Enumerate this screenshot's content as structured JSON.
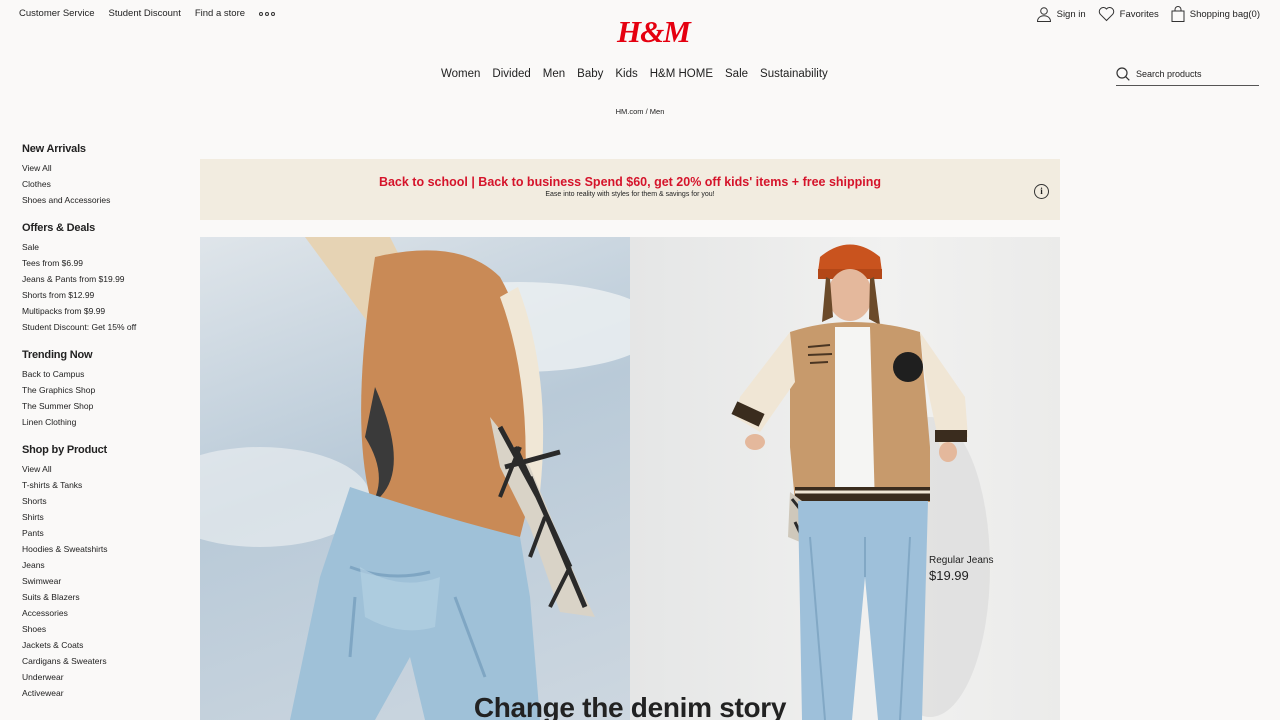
{
  "utility": {
    "customer_service": "Customer Service",
    "student_discount": "Student Discount",
    "find_store": "Find a store",
    "sign_in": "Sign in",
    "favorites": "Favorites",
    "shopping_bag": "Shopping bag(0)"
  },
  "logo": "H&M",
  "nav": [
    "Women",
    "Divided",
    "Men",
    "Baby",
    "Kids",
    "H&M HOME",
    "Sale",
    "Sustainability"
  ],
  "search": {
    "placeholder": "Search products"
  },
  "breadcrumb": "HM.com / Men",
  "sidebar": [
    {
      "title": "New Arrivals",
      "items": [
        "View All",
        "Clothes",
        "Shoes and Accessories"
      ]
    },
    {
      "title": "Offers & Deals",
      "items": [
        "Sale",
        "Tees from $6.99",
        "Jeans & Pants from $19.99",
        "Shorts from $12.99",
        "Multipacks from $9.99",
        "Student Discount: Get 15% off"
      ]
    },
    {
      "title": "Trending Now",
      "items": [
        "Back to Campus",
        "The Graphics Shop",
        "The Summer Shop",
        "Linen Clothing"
      ]
    },
    {
      "title": "Shop by Product",
      "items": [
        "View All",
        "T-shirts & Tanks",
        "Shorts",
        "Shirts",
        "Pants",
        "Hoodies & Sweatshirts",
        "Jeans",
        "Swimwear",
        "Suits & Blazers",
        "Accessories",
        "Shoes",
        "Jackets & Coats",
        "Cardigans & Sweaters",
        "Underwear",
        "Activewear"
      ]
    }
  ],
  "banner": {
    "headline": "Back to school | Back to business Spend $60, get 20% off kids' items + free shipping",
    "sub": "Ease into reality with styles for them & savings for you!",
    "info_glyph": "i"
  },
  "hero": {
    "product_name": "Regular Jeans",
    "product_price": "$19.99",
    "title": "Change the denim story"
  },
  "colors": {
    "brand_red": "#e50010",
    "promo_red": "#d5142b",
    "banner_bg": "#f2ece0"
  }
}
